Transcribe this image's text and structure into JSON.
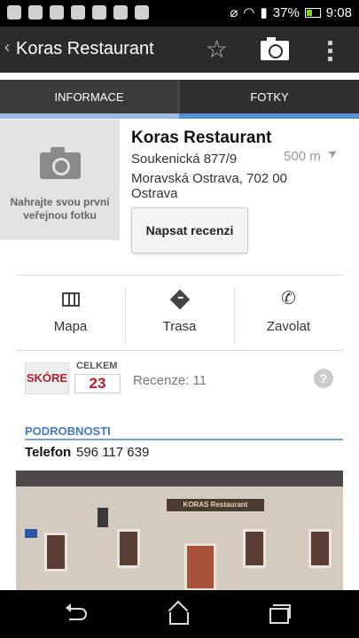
{
  "status_bar": {
    "battery": "37%",
    "time": "9:08",
    "icons": [
      "usb-icon",
      "bug-icon",
      "android-icon",
      "image-icon",
      "cat-icon",
      "sd-card-icon",
      "play-store-icon",
      "mute-icon",
      "wifi-icon",
      "signal-icon",
      "battery-icon"
    ],
    "battery_color": "#7bd31f"
  },
  "action_bar": {
    "title": "Koras Restaurant",
    "icons": [
      "back-chevron-icon",
      "star-icon",
      "camera-icon",
      "overflow-menu-icon"
    ]
  },
  "tabs": [
    {
      "label": "INFORMACE",
      "selected": true
    },
    {
      "label": "FOTKY",
      "selected": false
    }
  ],
  "place": {
    "photo_prompt": "Nahrajte svou první veřejnou fotku",
    "name": "Koras Restaurant",
    "address_line1": "Soukenická 877/9",
    "distance": "500 m",
    "address_line2": "Moravská Ostrava, 702 00",
    "address_line3": "Ostrava",
    "review_button": "Napsat recenzi"
  },
  "actions": [
    {
      "label": "Mapa",
      "icon": "map-icon"
    },
    {
      "label": "Trasa",
      "icon": "directions-icon"
    },
    {
      "label": "Zavolat",
      "icon": "phone-icon"
    }
  ],
  "score": {
    "label": "SKÓRE",
    "total_label": "CELKEM",
    "total_value": "23",
    "reviews": "Recenze: 11"
  },
  "details": {
    "title": "PODROBNOSTI",
    "phone_label": "Telefon",
    "phone_value": "596 117 639"
  },
  "photo": {
    "sign_text": "KORAS Restaurant"
  },
  "colors": {
    "accent": "#4678bf",
    "score_red": "#b21f2d",
    "tab_indicator": "#5a8fd0"
  }
}
